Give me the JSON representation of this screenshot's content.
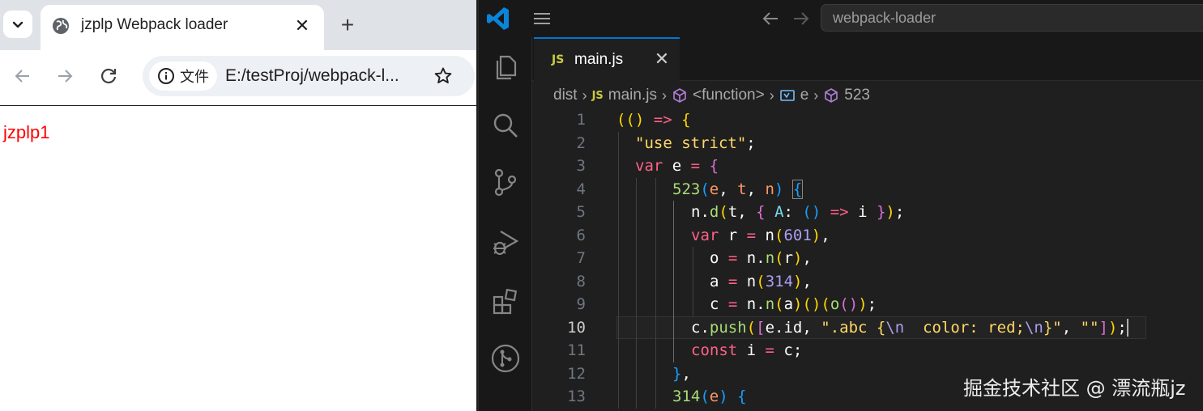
{
  "browser": {
    "tab_title": "jzplp Webpack loader",
    "tab_close": "✕",
    "new_tab": "+",
    "site_info_label": "文件",
    "address": "E:/testProj/webpack-l...",
    "page_text": "jzplp1",
    "page_text_color": "#ff0000"
  },
  "vscode": {
    "search_text": "webpack-loader",
    "tab": {
      "badge": "JS",
      "name": "main.js",
      "close": "✕"
    },
    "breadcrumbs": {
      "folder": "dist",
      "file_badge": "JS",
      "file": "main.js",
      "function": "<function>",
      "variable": "e",
      "member": "523"
    },
    "active_line": 10,
    "lines": [
      {
        "n": "1",
        "tokens": [
          [
            "t-p1",
            "(("
          ],
          [
            "t-p1",
            ")"
          ],
          [
            "t-kw",
            " =>"
          ],
          [
            "t-txt",
            " "
          ],
          [
            "t-p1",
            "{"
          ]
        ]
      },
      {
        "n": "2",
        "tokens": [
          [
            "t-str",
            "\"use strict\""
          ],
          [
            "t-txt",
            ";"
          ]
        ]
      },
      {
        "n": "3",
        "tokens": [
          [
            "t-kw",
            "var"
          ],
          [
            "t-var",
            " e"
          ],
          [
            "t-kw",
            " ="
          ],
          [
            "t-txt",
            " "
          ],
          [
            "t-p2",
            "{"
          ]
        ]
      },
      {
        "n": "4",
        "tokens": [
          [
            "t-fn",
            "523"
          ],
          [
            "t-p3",
            "("
          ],
          [
            "t-param",
            "e"
          ],
          [
            "t-txt",
            ", "
          ],
          [
            "t-param",
            "t"
          ],
          [
            "t-txt",
            ", "
          ],
          [
            "t-param",
            "n"
          ],
          [
            "t-p3",
            ")"
          ],
          [
            "t-txt",
            " "
          ],
          [
            "t-p3 bm",
            "{"
          ]
        ]
      },
      {
        "n": "5",
        "tokens": [
          [
            "t-var",
            "n"
          ],
          [
            "t-txt",
            "."
          ],
          [
            "t-fn",
            "d"
          ],
          [
            "t-p1",
            "("
          ],
          [
            "t-var",
            "t"
          ],
          [
            "t-txt",
            ", "
          ],
          [
            "t-p2",
            "{"
          ],
          [
            "t-txt",
            " "
          ],
          [
            "t-prop",
            "A"
          ],
          [
            "t-txt",
            ": "
          ],
          [
            "t-p3",
            "()"
          ],
          [
            "t-kw",
            " =>"
          ],
          [
            "t-var",
            " i"
          ],
          [
            "t-txt",
            " "
          ],
          [
            "t-p2",
            "}"
          ],
          [
            "t-p1",
            ")"
          ],
          [
            "t-txt",
            ";"
          ]
        ]
      },
      {
        "n": "6",
        "tokens": [
          [
            "t-kw",
            "var"
          ],
          [
            "t-var",
            " r"
          ],
          [
            "t-kw",
            " ="
          ],
          [
            "t-var",
            " n"
          ],
          [
            "t-p1",
            "("
          ],
          [
            "t-num",
            "601"
          ],
          [
            "t-p1",
            ")"
          ],
          [
            "t-txt",
            ","
          ]
        ]
      },
      {
        "n": "7",
        "tokens": [
          [
            "t-var",
            "o"
          ],
          [
            "t-kw",
            " ="
          ],
          [
            "t-var",
            " n"
          ],
          [
            "t-txt",
            "."
          ],
          [
            "t-fn",
            "n"
          ],
          [
            "t-p1",
            "("
          ],
          [
            "t-var",
            "r"
          ],
          [
            "t-p1",
            ")"
          ],
          [
            "t-txt",
            ","
          ]
        ]
      },
      {
        "n": "8",
        "tokens": [
          [
            "t-var",
            "a"
          ],
          [
            "t-kw",
            " ="
          ],
          [
            "t-var",
            " n"
          ],
          [
            "t-p1",
            "("
          ],
          [
            "t-num",
            "314"
          ],
          [
            "t-p1",
            ")"
          ],
          [
            "t-txt",
            ","
          ]
        ]
      },
      {
        "n": "9",
        "tokens": [
          [
            "t-var",
            "c"
          ],
          [
            "t-kw",
            " ="
          ],
          [
            "t-var",
            " n"
          ],
          [
            "t-txt",
            "."
          ],
          [
            "t-fn",
            "n"
          ],
          [
            "t-p1",
            "("
          ],
          [
            "t-var",
            "a"
          ],
          [
            "t-p1",
            ")"
          ],
          [
            "t-p1",
            "()"
          ],
          [
            "t-p1",
            "("
          ],
          [
            "t-fn",
            "o"
          ],
          [
            "t-p2",
            "()"
          ],
          [
            "t-p1",
            ")"
          ],
          [
            "t-txt",
            ";"
          ]
        ]
      },
      {
        "n": "10",
        "tokens": [
          [
            "t-var",
            "c"
          ],
          [
            "t-txt",
            "."
          ],
          [
            "t-fn",
            "push"
          ],
          [
            "t-p1",
            "("
          ],
          [
            "t-p2",
            "["
          ],
          [
            "t-var",
            "e"
          ],
          [
            "t-txt",
            "."
          ],
          [
            "t-var",
            "id"
          ],
          [
            "t-txt",
            ", "
          ],
          [
            "t-str",
            "\".abc {"
          ],
          [
            "t-esc",
            "\\n"
          ],
          [
            "t-str",
            "  color: red;"
          ],
          [
            "t-esc",
            "\\n"
          ],
          [
            "t-str",
            "}\""
          ],
          [
            "t-txt",
            ", "
          ],
          [
            "t-str",
            "\"\""
          ],
          [
            "t-p2",
            "]"
          ],
          [
            "t-p1",
            ")"
          ],
          [
            "t-txt",
            ";"
          ]
        ]
      },
      {
        "n": "11",
        "tokens": [
          [
            "t-kw",
            "const"
          ],
          [
            "t-var",
            " i"
          ],
          [
            "t-kw",
            " ="
          ],
          [
            "t-var",
            " c"
          ],
          [
            "t-txt",
            ";"
          ]
        ]
      },
      {
        "n": "12",
        "tokens": [
          [
            "t-p3",
            "}"
          ],
          [
            "t-txt",
            ","
          ]
        ]
      },
      {
        "n": "13",
        "tokens": [
          [
            "t-fn",
            "314"
          ],
          [
            "t-p3",
            "("
          ],
          [
            "t-param",
            "e"
          ],
          [
            "t-p3",
            ")"
          ],
          [
            "t-txt",
            " "
          ],
          [
            "t-p3",
            "{"
          ]
        ]
      }
    ]
  },
  "watermark": "掘金技术社区 @ 漂流瓶jz"
}
